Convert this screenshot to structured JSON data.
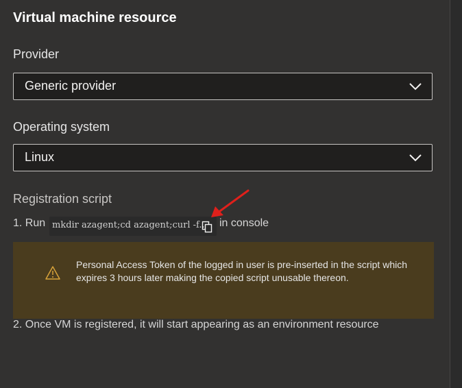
{
  "panel": {
    "title": "Virtual machine resource"
  },
  "provider": {
    "label": "Provider",
    "value": "Generic provider"
  },
  "operating_system": {
    "label": "Operating system",
    "value": "Linux"
  },
  "registration": {
    "title": "Registration script",
    "step1_prefix": "1. Run",
    "script_preview": "mkdir azagent;cd azagent;curl -f...",
    "step1_suffix": "in console",
    "warning_text": "Personal Access Token of the logged in user is pre-inserted in the script which expires 3 hours later making the copied script unusable thereon.",
    "step2": "2. Once VM is registered, it will start appearing as an environment resource"
  },
  "colors": {
    "panel_bg": "#323130",
    "warning_bg": "#4a3c1e",
    "warning_icon": "#d8a33a",
    "annotation_arrow": "#e0201b"
  },
  "icons": [
    "chevron-down-icon",
    "copy-icon",
    "warning-icon",
    "red-arrow-annotation"
  ]
}
